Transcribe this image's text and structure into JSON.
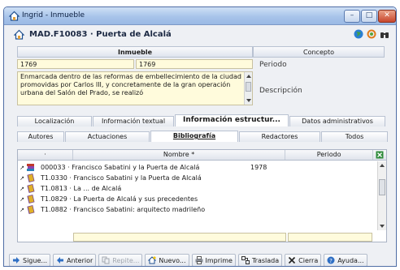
{
  "window": {
    "title": "Ingrid - Inmueble"
  },
  "window_controls": {
    "minimize": "–",
    "maximize": "□",
    "close": "✕"
  },
  "header": {
    "record_title": "MAD.F10083 · Puerta de Alcalá"
  },
  "columns": {
    "inmueble": "Inmueble",
    "concepto": "Concepto"
  },
  "fields": {
    "periodo_value1": "1769",
    "periodo_value2": "1769",
    "periodo_label": "Periodo",
    "descripcion_value": "Enmarcada dentro de las reformas de embellecimiento de la ciudad promovidas por Carlos III, y concretamente de la gran operación urbana del Salón del Prado, se realizó",
    "descripcion_label": "Descripción"
  },
  "main_tabs": [
    {
      "label": "Localización"
    },
    {
      "label": "Información textual"
    },
    {
      "label": "Información estructur..."
    },
    {
      "label": "Datos administrativos"
    }
  ],
  "sub_tabs": [
    {
      "label": "Autores"
    },
    {
      "label": "Actuaciones"
    },
    {
      "label": "Bibliografía"
    },
    {
      "label": "Redactores"
    },
    {
      "label": "Todos"
    }
  ],
  "grid": {
    "col_dot": "·",
    "col_name": "Nombre *",
    "col_period": "Periodo",
    "rows": [
      {
        "pointer": "↗",
        "name": "000033 · Francisco Sabatini y la Puerta de Alcalá",
        "period": "1978"
      },
      {
        "pointer": "↗",
        "name": "T1.0330 · Francisco Sabatini y la Puerta de Alcalá",
        "period": ""
      },
      {
        "pointer": "↗",
        "name": "T1.0813 · La ... de Alcalá",
        "period": ""
      },
      {
        "pointer": "↗",
        "name": "T1.0829 · La Puerta de Alcalá y sus precedentes",
        "period": ""
      },
      {
        "pointer": "↗",
        "name": "T1.0882 · Francisco Sabatini: arquitecto madrileño",
        "period": ""
      }
    ]
  },
  "toolbar": {
    "siguiente": "Sigue...",
    "anterior": "Anterior",
    "repite": "Repite...",
    "nuevo": "Nuevo...",
    "imprime": "Imprime",
    "traslada": "Traslada",
    "cierra": "Cierra",
    "ayuda": "Ayuda..."
  },
  "colors": {
    "accent": "#4f6ea6",
    "field_bg": "#fffbdc",
    "excel_green": "#2e8b3a"
  }
}
